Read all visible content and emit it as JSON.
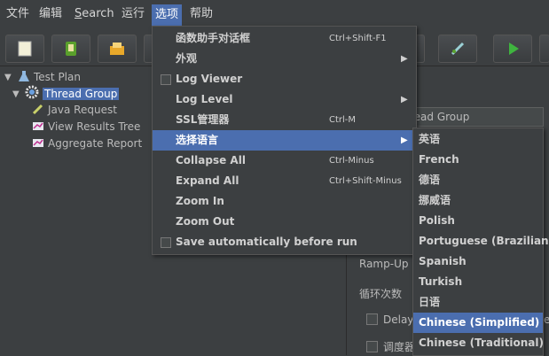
{
  "menubar": {
    "file": "文件",
    "edit": "编辑",
    "search_prefix": "S",
    "search_rest": "earch",
    "run": "运行",
    "options": "选项",
    "help": "帮助"
  },
  "tree": {
    "test_plan": "Test Plan",
    "thread_group": "Thread Group",
    "java_request": "Java Request",
    "view_results_tree": "View Results Tree",
    "aggregate_report": "Aggregate Report"
  },
  "panel": {
    "name_value": "read Group",
    "ramp_up": "Ramp-Up I",
    "loop_count": "循环次数",
    "delay": "Delay",
    "scheduler": "调度器",
    "edge_char": "e"
  },
  "options_menu": {
    "items": [
      {
        "label": "函数助手对话框",
        "shortcut": "Ctrl+Shift-F1"
      },
      {
        "label": "外观",
        "submenu": true
      },
      {
        "label": "Log Viewer",
        "checkbox": true
      },
      {
        "label": "Log Level",
        "submenu": true
      },
      {
        "label": "SSL管理器",
        "shortcut": "Ctrl-M"
      },
      {
        "label": "选择语言",
        "submenu": true,
        "highlighted": true
      },
      {
        "label": "Collapse All",
        "shortcut": "Ctrl-Minus"
      },
      {
        "label": "Expand All",
        "shortcut": "Ctrl+Shift-Minus"
      },
      {
        "label": "Zoom In"
      },
      {
        "label": "Zoom Out"
      },
      {
        "label": "Save automatically before run",
        "checkbox": true
      }
    ]
  },
  "language_menu": {
    "items": [
      {
        "label": "英语"
      },
      {
        "label": "French"
      },
      {
        "label": "德语"
      },
      {
        "label": "挪威语"
      },
      {
        "label": "Polish"
      },
      {
        "label": "Portuguese (Brazilian)"
      },
      {
        "label": "Spanish"
      },
      {
        "label": "Turkish"
      },
      {
        "label": "日语"
      },
      {
        "label": "Chinese (Simplified)",
        "highlighted": true
      },
      {
        "label": "Chinese (Traditional)"
      }
    ]
  },
  "colors": {
    "background": "#3c3f41",
    "selection": "#4b6eaf",
    "text": "#bbbbbb"
  },
  "icons": [
    "new-test-plan-icon",
    "templates-icon",
    "open-icon",
    "remote-icon",
    "start-icon",
    "test-plan-icon",
    "thread-group-gear-icon",
    "sampler-icon",
    "listener-icon"
  ]
}
